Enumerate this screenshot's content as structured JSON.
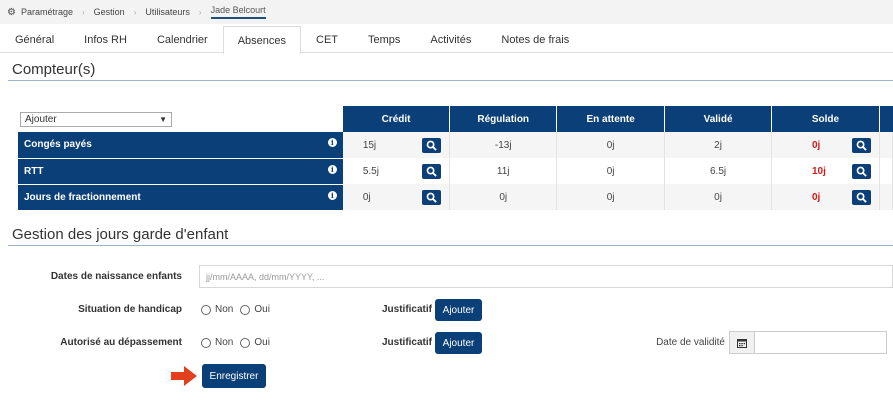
{
  "breadcrumb": {
    "icon": "gear-icon",
    "items": [
      "Paramétrage",
      "Gestion",
      "Utilisateurs"
    ],
    "current": "Jade Belcourt"
  },
  "tabs": [
    {
      "label": "Général",
      "active": false
    },
    {
      "label": "Infos RH",
      "active": false
    },
    {
      "label": "Calendrier",
      "active": false
    },
    {
      "label": "Absences",
      "active": true
    },
    {
      "label": "CET",
      "active": false
    },
    {
      "label": "Temps",
      "active": false
    },
    {
      "label": "Activités",
      "active": false
    },
    {
      "label": "Notes de frais",
      "active": false
    }
  ],
  "counters": {
    "title": "Compteur(s)",
    "add_select": "Ajouter",
    "columns": [
      "Crédit",
      "Régulation",
      "En attente",
      "Validé",
      "Solde"
    ],
    "rows": [
      {
        "label": "Congés payés",
        "credit": "15j",
        "regulation": "-13j",
        "pending": "0j",
        "validated": "2j",
        "balance": "0j"
      },
      {
        "label": "RTT",
        "credit": "5.5j",
        "regulation": "11j",
        "pending": "0j",
        "validated": "6.5j",
        "balance": "10j"
      },
      {
        "label": "Jours de fractionnement",
        "credit": "0j",
        "regulation": "0j",
        "pending": "0j",
        "validated": "0j",
        "balance": "0j"
      }
    ]
  },
  "childcare": {
    "title": "Gestion des jours garde d'enfant",
    "birth_dates_label": "Dates de naissance enfants",
    "birth_dates_placeholder": "jj/mm/AAAA, dd/mm/YYYY, ...",
    "handicap_label": "Situation de handicap",
    "overrun_label": "Autorisé au dépassement",
    "option_no": "Non",
    "option_yes": "Oui",
    "proof_label": "Justificatif",
    "add_button": "Ajouter",
    "validity_label": "Date de validité",
    "save_button": "Enregistrer"
  },
  "colors": {
    "header_blue": "#0b3f78",
    "negative_red": "#d11a1a",
    "arrow_orange": "#e2401c"
  }
}
